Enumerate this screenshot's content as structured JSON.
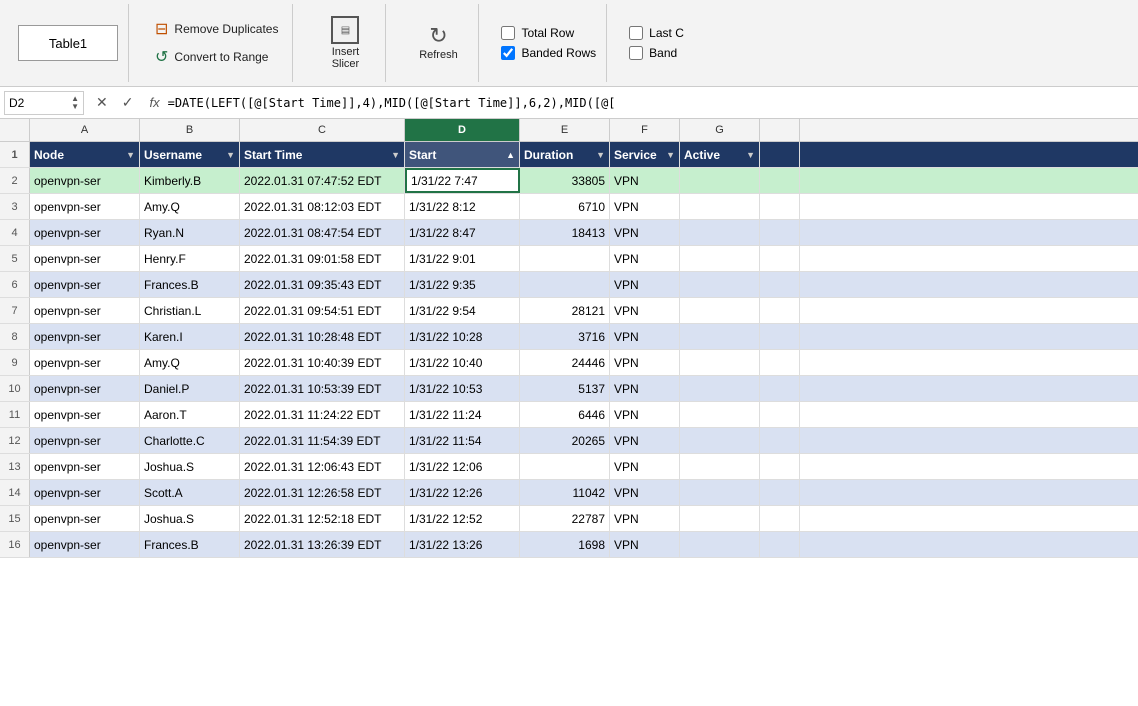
{
  "toolbar": {
    "table_name": "Table1",
    "remove_duplicates_label": "Remove Duplicates",
    "convert_to_range_label": "Convert to Range",
    "insert_slicer_label": "Insert\nSlicer",
    "refresh_label": "Refresh",
    "total_row_label": "Total Row",
    "banded_rows_label": "Banded Rows",
    "banded_cols_label": "Band",
    "total_row_checked": false,
    "banded_rows_checked": true,
    "last_col_label": "Last C"
  },
  "formula_bar": {
    "cell_ref": "D2",
    "formula": "=DATE(LEFT([@[Start Time]],4),MID([@[Start Time]],6,2),MID([@["
  },
  "columns": [
    {
      "letter": "A",
      "width_class": "col-a",
      "active": false
    },
    {
      "letter": "B",
      "width_class": "col-b",
      "active": false
    },
    {
      "letter": "C",
      "width_class": "col-c",
      "active": false
    },
    {
      "letter": "D",
      "width_class": "col-d",
      "active": true
    },
    {
      "letter": "E",
      "width_class": "col-e",
      "active": false
    },
    {
      "letter": "F",
      "width_class": "col-f",
      "active": false
    },
    {
      "letter": "G",
      "width_class": "col-g",
      "active": false
    },
    {
      "letter": "+",
      "width_class": "col-extra",
      "active": false
    }
  ],
  "table_headers": [
    {
      "label": "Node",
      "col_class": "col-a",
      "sort": "none"
    },
    {
      "label": "Username",
      "col_class": "col-b",
      "sort": "none"
    },
    {
      "label": "Start Time",
      "col_class": "col-c",
      "sort": "none"
    },
    {
      "label": "Start",
      "col_class": "col-d",
      "sort": "up"
    },
    {
      "label": "Duration",
      "col_class": "col-e",
      "sort": "none"
    },
    {
      "label": "Service",
      "col_class": "col-f",
      "sort": "none"
    },
    {
      "label": "Active",
      "col_class": "col-g",
      "sort": "none"
    },
    {
      "label": "",
      "col_class": "col-extra",
      "sort": "none"
    }
  ],
  "rows": [
    {
      "num": 2,
      "node": "openvpn-ser",
      "username": "Kimberly.B",
      "start_time": "2022.01.31 07:47:52 EDT",
      "start": "1/31/22 7:47",
      "duration": "33805",
      "service": "VPN",
      "active": "",
      "selected": true
    },
    {
      "num": 3,
      "node": "openvpn-ser",
      "username": "Amy.Q",
      "start_time": "2022.01.31 08:12:03 EDT",
      "start": "1/31/22 8:12",
      "duration": "6710",
      "service": "VPN",
      "active": ""
    },
    {
      "num": 4,
      "node": "openvpn-ser",
      "username": "Ryan.N",
      "start_time": "2022.01.31 08:47:54 EDT",
      "start": "1/31/22 8:47",
      "duration": "18413",
      "service": "VPN",
      "active": ""
    },
    {
      "num": 5,
      "node": "openvpn-ser",
      "username": "Henry.F",
      "start_time": "2022.01.31 09:01:58 EDT",
      "start": "1/31/22 9:01",
      "duration": "",
      "service": "VPN",
      "active": ""
    },
    {
      "num": 6,
      "node": "openvpn-ser",
      "username": "Frances.B",
      "start_time": "2022.01.31 09:35:43 EDT",
      "start": "1/31/22 9:35",
      "duration": "",
      "service": "VPN",
      "active": ""
    },
    {
      "num": 7,
      "node": "openvpn-ser",
      "username": "Christian.L",
      "start_time": "2022.01.31 09:54:51 EDT",
      "start": "1/31/22 9:54",
      "duration": "28121",
      "service": "VPN",
      "active": ""
    },
    {
      "num": 8,
      "node": "openvpn-ser",
      "username": "Karen.I",
      "start_time": "2022.01.31 10:28:48 EDT",
      "start": "1/31/22 10:28",
      "duration": "3716",
      "service": "VPN",
      "active": ""
    },
    {
      "num": 9,
      "node": "openvpn-ser",
      "username": "Amy.Q",
      "start_time": "2022.01.31 10:40:39 EDT",
      "start": "1/31/22 10:40",
      "duration": "24446",
      "service": "VPN",
      "active": ""
    },
    {
      "num": 10,
      "node": "openvpn-ser",
      "username": "Daniel.P",
      "start_time": "2022.01.31 10:53:39 EDT",
      "start": "1/31/22 10:53",
      "duration": "5137",
      "service": "VPN",
      "active": ""
    },
    {
      "num": 11,
      "node": "openvpn-ser",
      "username": "Aaron.T",
      "start_time": "2022.01.31 11:24:22 EDT",
      "start": "1/31/22 11:24",
      "duration": "6446",
      "service": "VPN",
      "active": ""
    },
    {
      "num": 12,
      "node": "openvpn-ser",
      "username": "Charlotte.C",
      "start_time": "2022.01.31 11:54:39 EDT",
      "start": "1/31/22 11:54",
      "duration": "20265",
      "service": "VPN",
      "active": ""
    },
    {
      "num": 13,
      "node": "openvpn-ser",
      "username": "Joshua.S",
      "start_time": "2022.01.31 12:06:43 EDT",
      "start": "1/31/22 12:06",
      "duration": "",
      "service": "VPN",
      "active": ""
    },
    {
      "num": 14,
      "node": "openvpn-ser",
      "username": "Scott.A",
      "start_time": "2022.01.31 12:26:58 EDT",
      "start": "1/31/22 12:26",
      "duration": "11042",
      "service": "VPN",
      "active": ""
    },
    {
      "num": 15,
      "node": "openvpn-ser",
      "username": "Joshua.S",
      "start_time": "2022.01.31 12:52:18 EDT",
      "start": "1/31/22 12:52",
      "duration": "22787",
      "service": "VPN",
      "active": ""
    },
    {
      "num": 16,
      "node": "openvpn-ser",
      "username": "Frances.B",
      "start_time": "2022.01.31 13:26:39 EDT",
      "start": "1/31/22 13:26",
      "duration": "1698",
      "service": "VPN",
      "active": ""
    }
  ]
}
